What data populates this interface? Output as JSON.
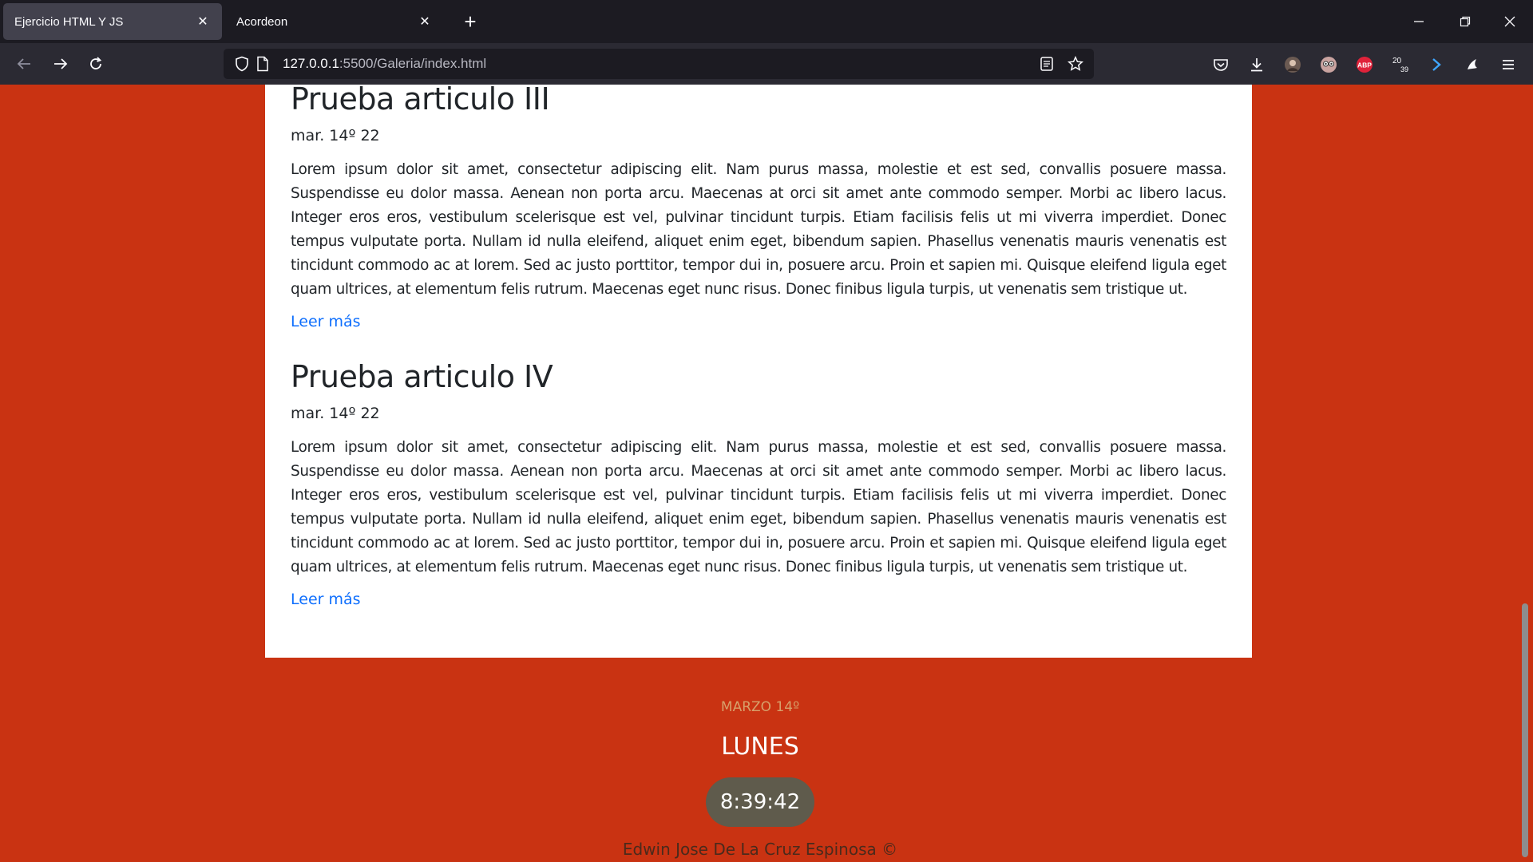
{
  "browser": {
    "tabs": [
      {
        "title": "Ejercicio HTML Y JS",
        "active": true
      },
      {
        "title": "Acordeon",
        "active": false
      }
    ],
    "url_host": "127.0.0.1",
    "url_rest": ":5500/Galeria/index.html"
  },
  "articles": [
    {
      "title": "Prueba articulo III",
      "date": "mar. 14º 22",
      "body": "Lorem ipsum dolor sit amet, consectetur adipiscing elit. Nam purus massa, molestie et est sed, convallis posuere massa. Suspendisse eu dolor massa. Aenean non porta arcu. Maecenas at orci sit amet ante commodo semper. Morbi ac libero lacus. Integer eros eros, vestibulum scelerisque est vel, pulvinar tincidunt turpis. Etiam facilisis felis ut mi viverra imperdiet. Donec tempus vulputate porta. Nullam id nulla eleifend, aliquet enim eget, bibendum sapien. Phasellus venenatis mauris venenatis est tincidunt commodo ac at lorem. Sed ac justo porttitor, tempor dui in, posuere arcu. Proin et sapien mi. Quisque eleifend ligula eget quam ultrices, at elementum felis rutrum. Maecenas eget nunc risus. Donec finibus ligula turpis, ut venenatis sem tristique ut.",
      "link": "Leer más"
    },
    {
      "title": "Prueba articulo IV",
      "date": "mar. 14º 22",
      "body": "Lorem ipsum dolor sit amet, consectetur adipiscing elit. Nam purus massa, molestie et est sed, convallis posuere massa. Suspendisse eu dolor massa. Aenean non porta arcu. Maecenas at orci sit amet ante commodo semper. Morbi ac libero lacus. Integer eros eros, vestibulum scelerisque est vel, pulvinar tincidunt turpis. Etiam facilisis felis ut mi viverra imperdiet. Donec tempus vulputate porta. Nullam id nulla eleifend, aliquet enim eget, bibendum sapien. Phasellus venenatis mauris venenatis est tincidunt commodo ac at lorem. Sed ac justo porttitor, tempor dui in, posuere arcu. Proin et sapien mi. Quisque eleifend ligula eget quam ultrices, at elementum felis rutrum. Maecenas eget nunc risus. Donec finibus ligula turpis, ut venenatis sem tristique ut.",
      "link": "Leer más"
    }
  ],
  "footer": {
    "date": "MARZO 14º",
    "day": "LUNES",
    "clock": "8:39:42",
    "author": "Edwin Jose De La Cruz Espinosa ©"
  },
  "icons": {
    "ext_badge_text": "ABP",
    "ext_counter_top": "20",
    "ext_counter_bottom": "39"
  },
  "colors": {
    "page_background": "#c93312",
    "link": "#0d6efd",
    "clock_pill": "#5f5b4c"
  }
}
